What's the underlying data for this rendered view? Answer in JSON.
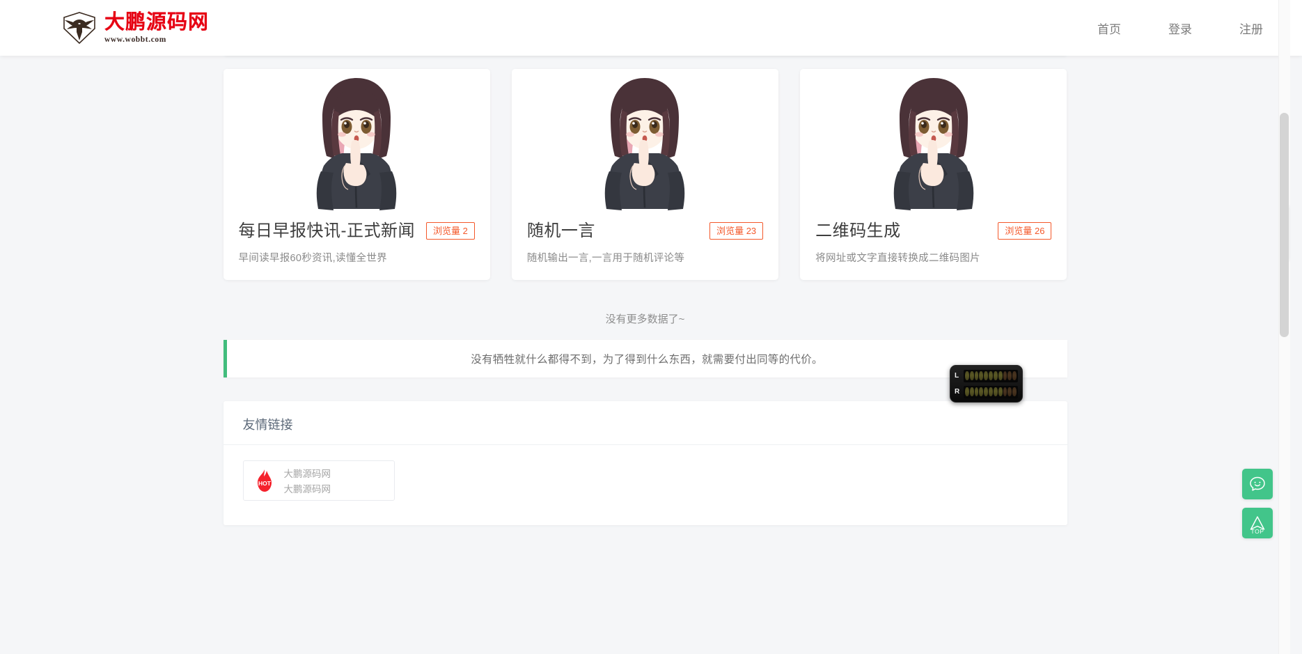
{
  "header": {
    "brand_name": "大鹏源码网",
    "brand_url": "www.wobbt.com",
    "nav": [
      {
        "label": "首页",
        "name": "nav-home"
      },
      {
        "label": "登录",
        "name": "nav-login"
      },
      {
        "label": "注册",
        "name": "nav-register"
      }
    ]
  },
  "cards": [
    {
      "title": "每日早报快讯-正式新闻",
      "badge": "浏览量 2",
      "desc": "早间读早报60秒资讯,读懂全世界"
    },
    {
      "title": "随机一言",
      "badge": "浏览量 23",
      "desc": "随机输出一言,一言用于随机评论等"
    },
    {
      "title": "二维码生成",
      "badge": "浏览量 26",
      "desc": "将网址或文字直接转换成二维码图片"
    }
  ],
  "no_more_text": "没有更多数据了~",
  "quote": "没有牺牲就什么都得不到，为了得到什么东西，就需要付出同等的代价。",
  "friend_links": {
    "title": "友情链接",
    "items": [
      {
        "name": "大鹏源码网",
        "sub": "大鹏源码网",
        "icon_label": "HOT"
      }
    ]
  },
  "floating_buttons": [
    {
      "name": "chat-bubble-button",
      "icon": "smiley-chat-icon",
      "label": ""
    },
    {
      "name": "back-to-top-button",
      "icon": "arrow-up-icon",
      "label": "TOP"
    }
  ],
  "audio_meter": {
    "left_label": "L",
    "right_label": "R",
    "segment_count": 11
  },
  "colors": {
    "brand_red": "#e60012",
    "badge_orange": "#f4582a",
    "accent_green": "#42c58a",
    "quote_border_green": "#42bd7d",
    "page_background": "#f5f6f8"
  }
}
